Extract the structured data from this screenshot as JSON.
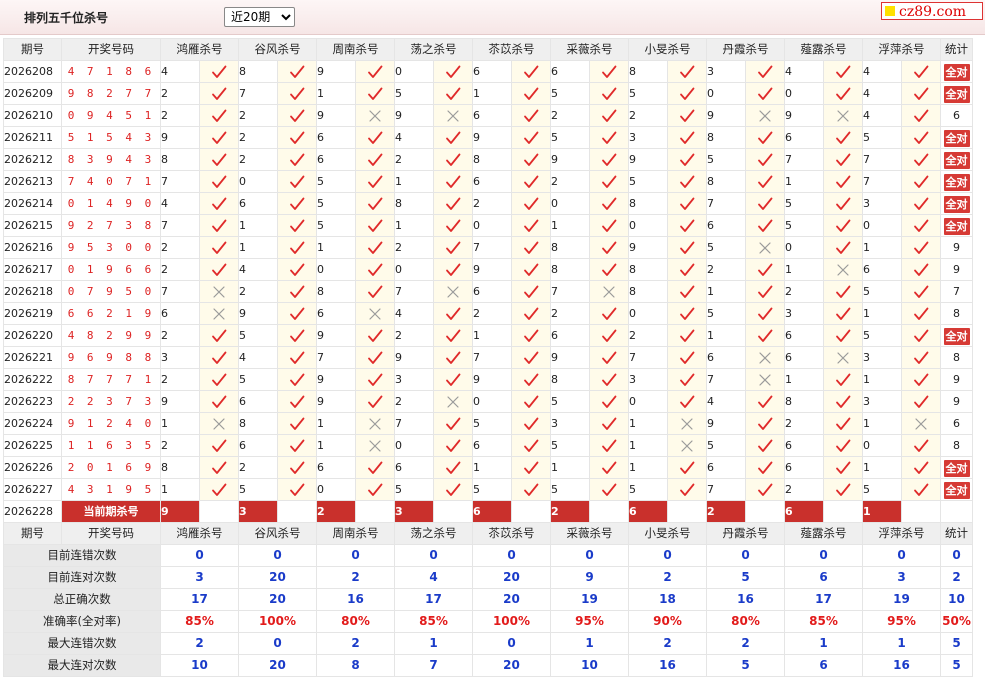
{
  "header": {
    "title": "排列五千位杀号",
    "period_selected": "近20期",
    "period_options": [
      "近20期"
    ],
    "logo_text": "cz89.com"
  },
  "columns": {
    "period": "期号",
    "numbers": "开奖号码",
    "experts": [
      "鸿雁杀号",
      "谷风杀号",
      "周南杀号",
      "荡之杀号",
      "苶苡杀号",
      "采薇杀号",
      "小旻杀号",
      "丹霞杀号",
      "薤露杀号",
      "浮萍杀号"
    ],
    "stat": "统计"
  },
  "all_correct_label": "全对",
  "rows": [
    {
      "p": "2026208",
      "n": "4 7 1 8 6",
      "k": [
        4,
        8,
        9,
        0,
        6,
        6,
        8,
        3,
        4,
        4
      ],
      "r": [
        1,
        1,
        1,
        1,
        1,
        1,
        1,
        1,
        1,
        1
      ],
      "s": "全对"
    },
    {
      "p": "2026209",
      "n": "9 8 2 7 7",
      "k": [
        2,
        7,
        1,
        5,
        1,
        5,
        5,
        0,
        0,
        4
      ],
      "r": [
        1,
        1,
        1,
        1,
        1,
        1,
        1,
        1,
        1,
        1
      ],
      "s": "全对"
    },
    {
      "p": "2026210",
      "n": "0 9 4 5 1",
      "k": [
        2,
        2,
        9,
        9,
        6,
        2,
        2,
        9,
        9,
        4
      ],
      "r": [
        1,
        1,
        0,
        0,
        1,
        1,
        1,
        0,
        0,
        1
      ],
      "s": "6"
    },
    {
      "p": "2026211",
      "n": "5 1 5 4 3",
      "k": [
        9,
        2,
        6,
        4,
        9,
        5,
        3,
        8,
        6,
        5
      ],
      "r": [
        1,
        1,
        1,
        1,
        1,
        1,
        1,
        1,
        1,
        1
      ],
      "s": "全对"
    },
    {
      "p": "2026212",
      "n": "8 3 9 4 3",
      "k": [
        8,
        2,
        6,
        2,
        8,
        9,
        9,
        5,
        7,
        7
      ],
      "r": [
        1,
        1,
        1,
        1,
        1,
        1,
        1,
        1,
        1,
        1
      ],
      "s": "全对"
    },
    {
      "p": "2026213",
      "n": "7 4 0 7 1",
      "k": [
        7,
        0,
        5,
        1,
        6,
        2,
        5,
        8,
        1,
        7
      ],
      "r": [
        1,
        1,
        1,
        1,
        1,
        1,
        1,
        1,
        1,
        1
      ],
      "s": "全对"
    },
    {
      "p": "2026214",
      "n": "0 1 4 9 0",
      "k": [
        4,
        6,
        5,
        8,
        2,
        0,
        8,
        7,
        5,
        3
      ],
      "r": [
        1,
        1,
        1,
        1,
        1,
        1,
        1,
        1,
        1,
        1
      ],
      "s": "全对"
    },
    {
      "p": "2026215",
      "n": "9 2 7 3 8",
      "k": [
        7,
        1,
        5,
        1,
        0,
        1,
        0,
        6,
        5,
        0
      ],
      "r": [
        1,
        1,
        1,
        1,
        1,
        1,
        1,
        1,
        1,
        1
      ],
      "s": "全对"
    },
    {
      "p": "2026216",
      "n": "9 5 3 0 0",
      "k": [
        2,
        1,
        1,
        2,
        7,
        8,
        9,
        5,
        0,
        1
      ],
      "r": [
        1,
        1,
        1,
        1,
        1,
        1,
        1,
        0,
        1,
        1
      ],
      "s": "9"
    },
    {
      "p": "2026217",
      "n": "0 1 9 6 6",
      "k": [
        2,
        4,
        0,
        0,
        9,
        8,
        8,
        2,
        1,
        6
      ],
      "r": [
        1,
        1,
        1,
        1,
        1,
        1,
        1,
        1,
        0,
        1
      ],
      "s": "9"
    },
    {
      "p": "2026218",
      "n": "0 7 9 5 0",
      "k": [
        7,
        2,
        8,
        7,
        6,
        7,
        8,
        1,
        2,
        5
      ],
      "r": [
        0,
        1,
        1,
        0,
        1,
        0,
        1,
        1,
        1,
        1
      ],
      "s": "7"
    },
    {
      "p": "2026219",
      "n": "6 6 2 1 9",
      "k": [
        6,
        9,
        6,
        4,
        2,
        2,
        0,
        5,
        3,
        1
      ],
      "r": [
        0,
        1,
        0,
        1,
        1,
        1,
        1,
        1,
        1,
        1
      ],
      "s": "8"
    },
    {
      "p": "2026220",
      "n": "4 8 2 9 9",
      "k": [
        2,
        5,
        9,
        2,
        1,
        6,
        2,
        1,
        6,
        5
      ],
      "r": [
        1,
        1,
        1,
        1,
        1,
        1,
        1,
        1,
        1,
        1
      ],
      "s": "全对"
    },
    {
      "p": "2026221",
      "n": "9 6 9 8 8",
      "k": [
        3,
        4,
        7,
        9,
        7,
        9,
        7,
        6,
        6,
        3
      ],
      "r": [
        1,
        1,
        1,
        1,
        1,
        1,
        1,
        0,
        0,
        1
      ],
      "s": "8"
    },
    {
      "p": "2026222",
      "n": "8 7 7 7 1",
      "k": [
        2,
        5,
        9,
        3,
        9,
        8,
        3,
        7,
        1,
        1
      ],
      "r": [
        1,
        1,
        1,
        1,
        1,
        1,
        1,
        0,
        1,
        1
      ],
      "s": "9"
    },
    {
      "p": "2026223",
      "n": "2 2 3 7 3",
      "k": [
        9,
        6,
        9,
        2,
        0,
        5,
        0,
        4,
        8,
        3
      ],
      "r": [
        1,
        1,
        1,
        0,
        1,
        1,
        1,
        1,
        1,
        1
      ],
      "s": "9"
    },
    {
      "p": "2026224",
      "n": "9 1 2 4 0",
      "k": [
        1,
        8,
        1,
        7,
        5,
        3,
        1,
        9,
        2,
        1
      ],
      "r": [
        0,
        1,
        0,
        1,
        1,
        1,
        0,
        1,
        1,
        0
      ],
      "s": "6"
    },
    {
      "p": "2026225",
      "n": "1 1 6 3 5",
      "k": [
        2,
        6,
        1,
        0,
        6,
        5,
        1,
        5,
        6,
        0
      ],
      "r": [
        1,
        1,
        0,
        1,
        1,
        1,
        0,
        1,
        1,
        1
      ],
      "s": "8"
    },
    {
      "p": "2026226",
      "n": "2 0 1 6 9",
      "k": [
        8,
        2,
        6,
        6,
        1,
        1,
        1,
        6,
        6,
        1
      ],
      "r": [
        1,
        1,
        1,
        1,
        1,
        1,
        1,
        1,
        1,
        1
      ],
      "s": "全对"
    },
    {
      "p": "2026227",
      "n": "4 3 1 9 5",
      "k": [
        1,
        5,
        0,
        5,
        5,
        5,
        5,
        7,
        2,
        5
      ],
      "r": [
        1,
        1,
        1,
        1,
        1,
        1,
        1,
        1,
        1,
        1
      ],
      "s": "全对"
    }
  ],
  "current": {
    "p": "2026228",
    "label": "当前期杀号",
    "kills": [
      9,
      3,
      2,
      3,
      6,
      2,
      6,
      2,
      6,
      1
    ]
  },
  "summary": [
    {
      "label": "目前连错次数",
      "values": [
        "0",
        "0",
        "0",
        "0",
        "0",
        "0",
        "0",
        "0",
        "0",
        "0"
      ],
      "stat": "0"
    },
    {
      "label": "目前连对次数",
      "values": [
        "3",
        "20",
        "2",
        "4",
        "20",
        "9",
        "2",
        "5",
        "6",
        "3"
      ],
      "stat": "2"
    },
    {
      "label": "总正确次数",
      "values": [
        "17",
        "20",
        "16",
        "17",
        "20",
        "19",
        "18",
        "16",
        "17",
        "19"
      ],
      "stat": "10"
    },
    {
      "label": "准确率(全对率)",
      "values": [
        "85%",
        "100%",
        "80%",
        "85%",
        "100%",
        "95%",
        "90%",
        "80%",
        "85%",
        "95%"
      ],
      "stat": "50%"
    },
    {
      "label": "最大连错次数",
      "values": [
        "2",
        "0",
        "2",
        "1",
        "0",
        "1",
        "2",
        "2",
        "1",
        "1"
      ],
      "stat": "5"
    },
    {
      "label": "最大连对次数",
      "values": [
        "10",
        "20",
        "8",
        "7",
        "20",
        "10",
        "16",
        "5",
        "6",
        "16"
      ],
      "stat": "5"
    }
  ],
  "colors": {
    "accent": "#c9302c",
    "check": "#e02a2a",
    "cross": "#9a9a9a",
    "summary_value": "#1a3bc9",
    "rate_value": "#e21b1b",
    "kill_cell_bg": "#fffbea"
  }
}
